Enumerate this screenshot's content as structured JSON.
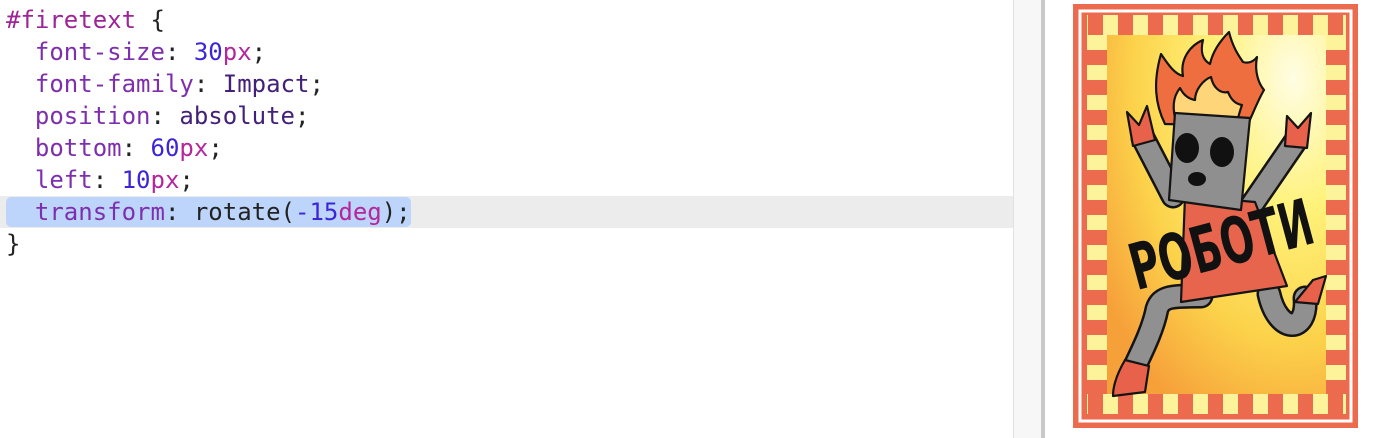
{
  "editor": {
    "lines": [
      [
        "#firetext",
        " {"
      ],
      [
        "  font-size",
        ": ",
        "30",
        "px",
        ";"
      ],
      [
        "  font-family",
        ": ",
        "Impact",
        ";"
      ],
      [
        "  position",
        ": ",
        "absolute",
        ";"
      ],
      [
        "  bottom",
        ": ",
        "60",
        "px",
        ";"
      ],
      [
        "  left",
        ": ",
        "10",
        "px",
        ";"
      ],
      [
        "  transform",
        ": ",
        "rotate(",
        "-15",
        "deg",
        ");"
      ],
      [
        "}"
      ]
    ]
  },
  "preview": {
    "card_text": "РОБОТИ"
  },
  "theme": {
    "selector": "#9c2598",
    "property": "#7e2fae",
    "number": "#3b25d6",
    "unit": "#b4269c",
    "value": "#43207a",
    "punctuation": "#222222",
    "selection": "#bdd5fb",
    "active_line": "#ececec",
    "card_orange": "#ec6b4f",
    "card_yellow": "#fdf39a"
  }
}
